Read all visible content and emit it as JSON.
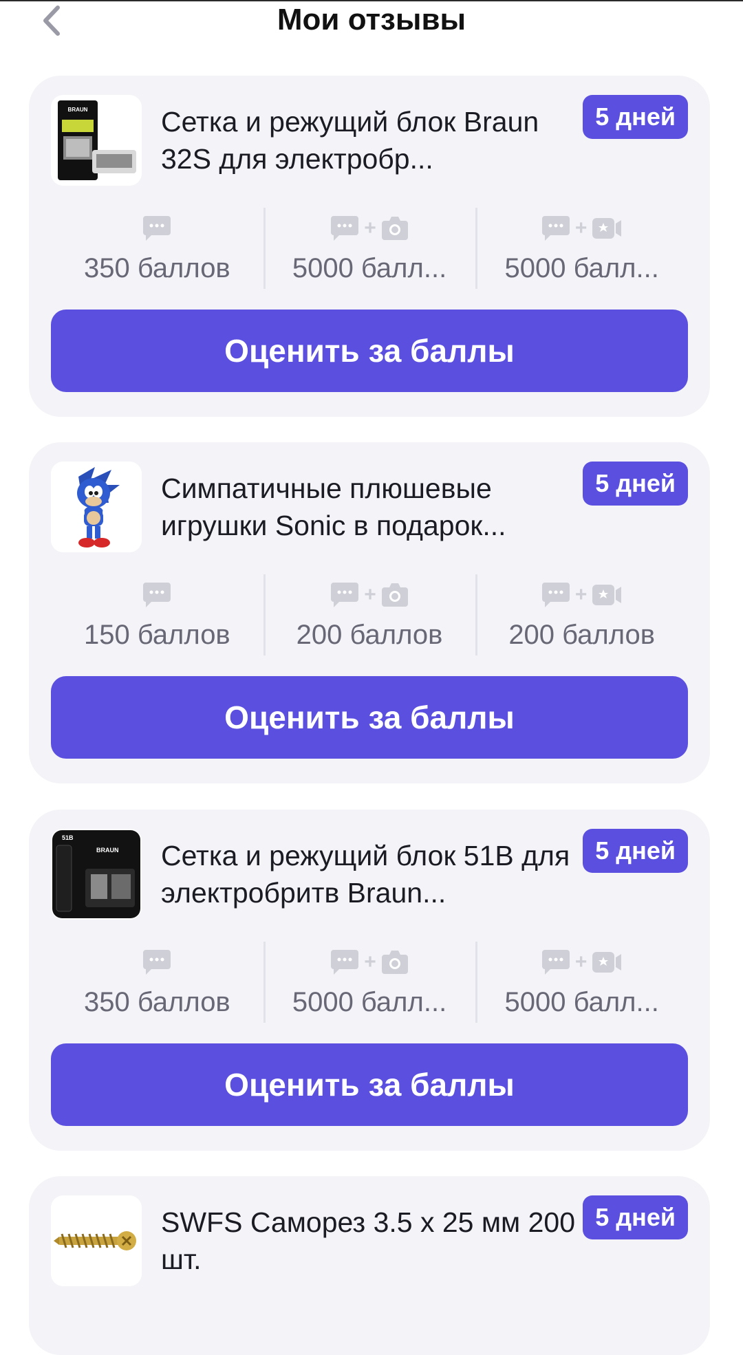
{
  "header": {
    "title": "Мои отзывы",
    "back_icon": "chevron-left-icon"
  },
  "colors": {
    "accent": "#5b4fe0",
    "card_bg": "#f3f3f8",
    "icon_gray": "#cfcfd8",
    "points_text": "#676776"
  },
  "reward_icons": [
    "chat-icon",
    "chat-plus-camera-icon",
    "chat-plus-video-icon"
  ],
  "cards": [
    {
      "thumb": "braun-32s-box",
      "name": "Сетка и режущий блок Braun 32S для электробр...",
      "badge": "5 дней",
      "points": [
        "350 баллов",
        "5000 балл...",
        "5000 балл..."
      ],
      "button": "Оценить за баллы"
    },
    {
      "thumb": "sonic-plush",
      "name": "Симпатичные плюшевые игрушки Sonic в подарок...",
      "badge": "5 дней",
      "points": [
        "150 баллов",
        "200 баллов",
        "200 баллов"
      ],
      "button": "Оценить за баллы"
    },
    {
      "thumb": "braun-51b-box",
      "name": "Сетка и режущий блок 51B для электробритв Braun...",
      "badge": "5 дней",
      "points": [
        "350 баллов",
        "5000 балл...",
        "5000 балл..."
      ],
      "button": "Оценить за баллы"
    },
    {
      "thumb": "screw",
      "name": "SWFS Саморез 3.5 x 25 мм 200 шт.",
      "badge": "5 дней"
    }
  ]
}
